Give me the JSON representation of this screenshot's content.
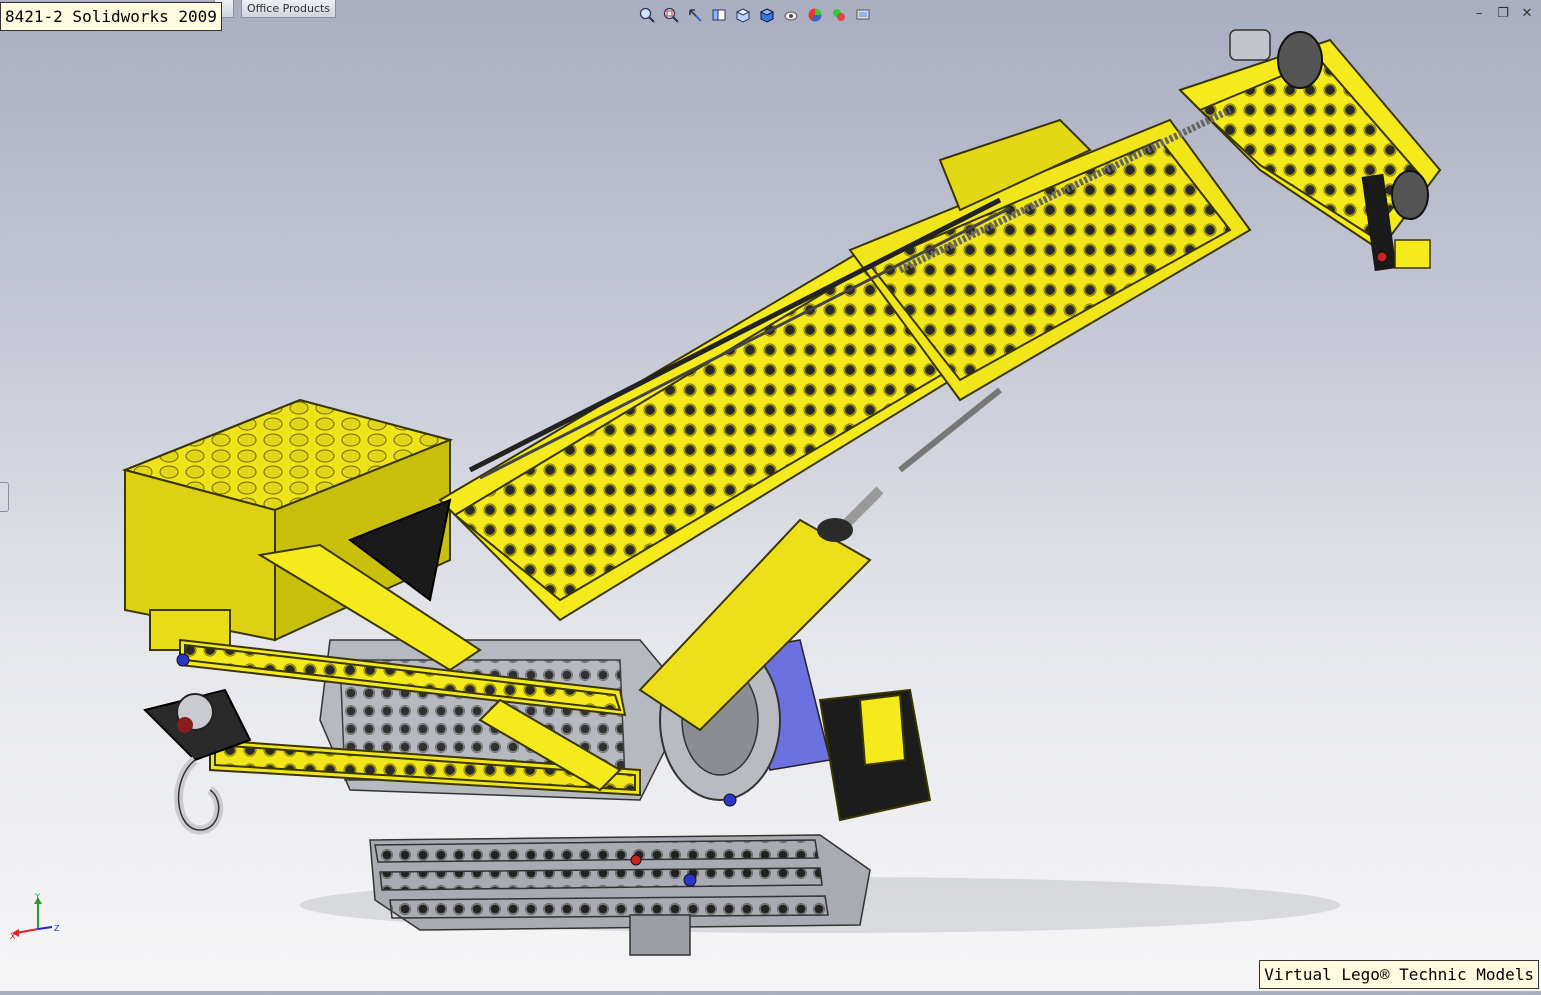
{
  "window": {
    "title": "8421-2 Solidworks 2009"
  },
  "command_manager": {
    "tab_office": "Office Products",
    "tab_partial": "e"
  },
  "hud_toolbar": {
    "icons": [
      "zoom-to-fit-icon",
      "zoom-to-area-icon",
      "previous-view-icon",
      "section-view-icon",
      "view-orientation-icon",
      "display-style-icon",
      "hide-show-items-icon",
      "edit-appearance-icon",
      "apply-scene-icon",
      "view-settings-icon"
    ]
  },
  "triad": {
    "x_label": "X",
    "y_label": "Y",
    "z_label": "Z"
  },
  "watermark": {
    "text": "Virtual Lego® Technic Models"
  },
  "colors": {
    "yellow": "#f4ea1c",
    "yellow_dark": "#b6a800",
    "black": "#151515",
    "gray": "#a9abb3",
    "blue": "#6d71e0"
  }
}
